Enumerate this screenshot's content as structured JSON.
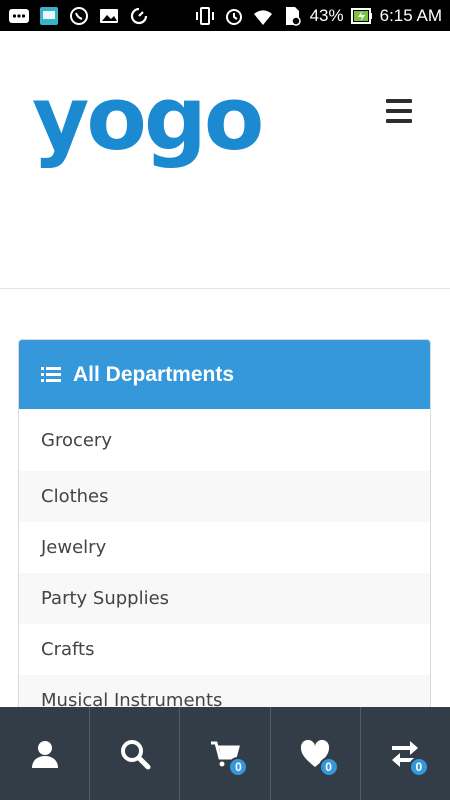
{
  "status_bar": {
    "battery": "43%",
    "time": "6:15 AM",
    "icons_left": [
      "notification-dots-icon",
      "app-icon",
      "whatsapp-icon",
      "image-icon",
      "sync-icon"
    ],
    "icons_right": [
      "vibrate-icon",
      "alarm-icon",
      "wifi-icon",
      "sim-icon",
      "battery-charging-icon"
    ]
  },
  "header": {
    "logo_text": "yogo",
    "logo_color": "#1b8ad0",
    "menu_icon": "hamburger-icon"
  },
  "departments": {
    "title": "All Departments",
    "icon": "list-icon",
    "accent": "#3498db",
    "items": [
      {
        "label": "Grocery"
      },
      {
        "label": "Clothes"
      },
      {
        "label": "Jewelry"
      },
      {
        "label": "Party Supplies"
      },
      {
        "label": "Crafts"
      },
      {
        "label": "Musical Instruments"
      }
    ]
  },
  "bottom_nav": {
    "background": "#333d47",
    "items": [
      {
        "icon": "user-icon"
      },
      {
        "icon": "search-icon"
      },
      {
        "icon": "cart-icon",
        "badge": "0"
      },
      {
        "icon": "heart-icon",
        "badge": "0"
      },
      {
        "icon": "compare-icon",
        "badge": "0"
      }
    ]
  }
}
